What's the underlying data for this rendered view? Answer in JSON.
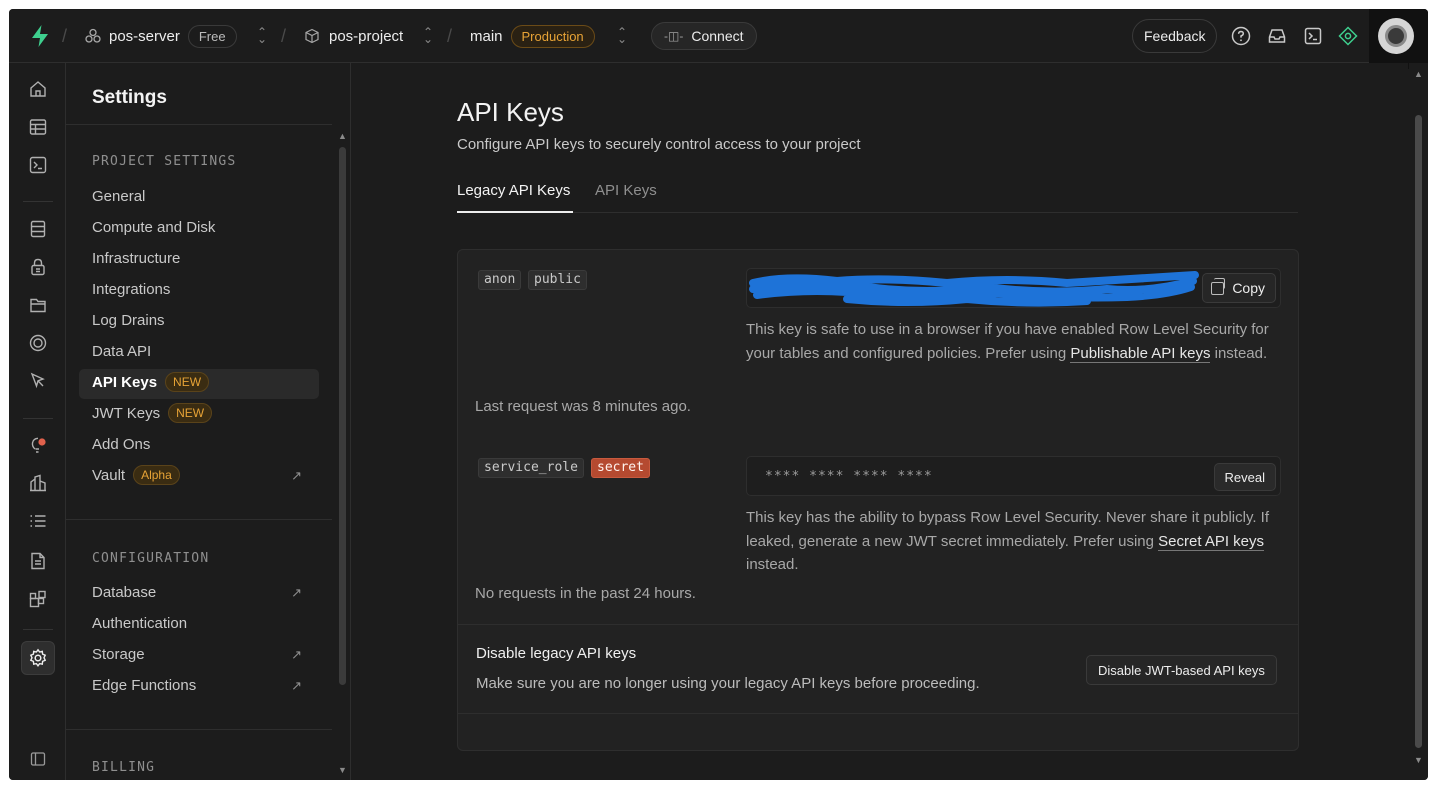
{
  "topbar": {
    "org_name": "pos-server",
    "org_plan": "Free",
    "project_name": "pos-project",
    "branch_name": "main",
    "branch_env": "Production",
    "connect_label": "Connect",
    "feedback_label": "Feedback",
    "icons": [
      "help-icon",
      "inbox-icon",
      "terminal-icon",
      "advisor-icon"
    ]
  },
  "rail": {
    "icons": [
      "home-icon",
      "table-editor-icon",
      "sql-editor-icon",
      "database-icon",
      "auth-icon",
      "storage-icon",
      "edge-functions-icon",
      "realtime-icon",
      "advisors-icon",
      "reports-icon",
      "logs-icon",
      "api-docs-icon",
      "integrations-icon",
      "settings-icon",
      "collapse-sidebar-icon"
    ]
  },
  "sidebar": {
    "title": "Settings",
    "project_settings": {
      "heading": "PROJECT SETTINGS",
      "items": [
        {
          "label": "General"
        },
        {
          "label": "Compute and Disk"
        },
        {
          "label": "Infrastructure"
        },
        {
          "label": "Integrations"
        },
        {
          "label": "Log Drains"
        },
        {
          "label": "Data API"
        },
        {
          "label": "API Keys",
          "badge": "NEW"
        },
        {
          "label": "JWT Keys",
          "badge": "NEW"
        },
        {
          "label": "Add Ons"
        },
        {
          "label": "Vault",
          "badge": "Alpha",
          "external": "↗"
        }
      ]
    },
    "configuration": {
      "heading": "CONFIGURATION",
      "items": [
        {
          "label": "Database",
          "external": "↗"
        },
        {
          "label": "Authentication"
        },
        {
          "label": "Storage",
          "external": "↗"
        },
        {
          "label": "Edge Functions",
          "external": "↗"
        }
      ]
    },
    "billing": {
      "heading": "BILLING"
    }
  },
  "main": {
    "title": "API Keys",
    "subtitle": "Configure API keys to securely control access to your project",
    "tabs": [
      {
        "label": "Legacy API Keys",
        "active": true
      },
      {
        "label": "API Keys",
        "active": false
      }
    ],
    "anon": {
      "tags": [
        "anon",
        "public"
      ],
      "copy_label": "Copy",
      "desc_1": "This key is safe to use in a browser if you have enabled Row Level Security for your tables and configured policies. Prefer using ",
      "desc_link": "Publishable API keys",
      "desc_2": " instead.",
      "last_request": "Last request was 8 minutes ago."
    },
    "service": {
      "tags": [
        "service_role",
        "secret"
      ],
      "masked_value": "**** **** **** ****",
      "reveal_label": "Reveal",
      "desc_1": "This key has the ability to bypass Row Level Security. Never share it publicly. If leaked, generate a new JWT secret immediately. Prefer using ",
      "desc_link": "Secret API keys",
      "desc_2": " instead.",
      "last_request": "No requests in the past 24 hours."
    },
    "disable": {
      "title": "Disable legacy API keys",
      "subtitle": "Make sure you are no longer using your legacy API keys before proceeding.",
      "button_label": "Disable JWT-based API keys"
    }
  },
  "colors": {
    "background": "#1c1c1c",
    "brand_green": "#3ecf8e",
    "badge_orange": "#e7a336",
    "secret_tag": "#b54a30",
    "redaction_blue": "#1e73d8"
  }
}
